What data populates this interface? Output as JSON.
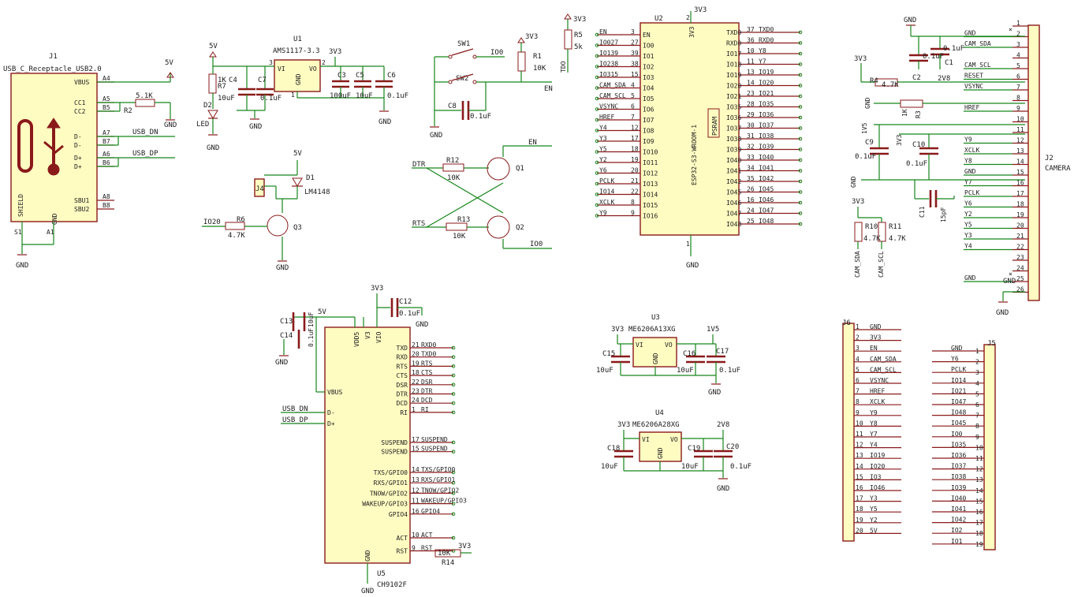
{
  "symbols": {
    "usb": {
      "ref": "J1",
      "value": "USB_C_Receptacle_USB2.0",
      "pins": [
        {
          "num": "A4",
          "name": "VBUS"
        },
        {
          "num": "A5",
          "name": "CC1"
        },
        {
          "num": "B5",
          "name": "CC2"
        },
        {
          "num": "A7",
          "name": "D-"
        },
        {
          "num": "B7",
          "name": "D-"
        },
        {
          "num": "A6",
          "name": "D+"
        },
        {
          "num": "B6",
          "name": "D+"
        },
        {
          "num": "A8",
          "name": "SBU1"
        },
        {
          "num": "B8",
          "name": "SBU2"
        }
      ],
      "shield_label": "SHIELD",
      "gnd_label": "GND",
      "s1": "S1",
      "a1": "A1"
    },
    "ldo": {
      "ref": "U1",
      "value": "AMS1117-3.3",
      "vi": "VI",
      "vo": "VO",
      "gnd": "GND",
      "pin_vi": "3",
      "pin_vo": "2",
      "pin_gnd": "1"
    },
    "esp": {
      "ref": "U2",
      "value": "ESP32-S3-WROOM-1",
      "psram": "PSRAM",
      "left_pins": [
        {
          "num": "3",
          "name": "EN",
          "net": "EN"
        },
        {
          "num": "27",
          "name": "IO0",
          "net": "IO027"
        },
        {
          "num": "39",
          "name": "IO1",
          "net": "IO139"
        },
        {
          "num": "38",
          "name": "IO2",
          "net": "IO238"
        },
        {
          "num": "15",
          "name": "IO3",
          "net": "IO315"
        },
        {
          "num": "4",
          "name": "IO4",
          "net": "CAM_SDA"
        },
        {
          "num": "5",
          "name": "IO5",
          "net": "CAM_SCL"
        },
        {
          "num": "6",
          "name": "IO6",
          "net": "VSYNC"
        },
        {
          "num": "7",
          "name": "IO7",
          "net": "HREF"
        },
        {
          "num": "12",
          "name": "IO8",
          "net": "Y4"
        },
        {
          "num": "17",
          "name": "IO9",
          "net": "Y3"
        },
        {
          "num": "18",
          "name": "IO10",
          "net": "Y5"
        },
        {
          "num": "19",
          "name": "IO11",
          "net": "Y2"
        },
        {
          "num": "20",
          "name": "IO12",
          "net": "Y6"
        },
        {
          "num": "21",
          "name": "IO13",
          "net": "PCLK"
        },
        {
          "num": "22",
          "name": "IO14",
          "net": "IO14"
        },
        {
          "num": "8",
          "name": "IO15",
          "net": "XCLK"
        },
        {
          "num": "9",
          "name": "IO16",
          "net": "Y9"
        }
      ],
      "right_pins": [
        {
          "num": "37",
          "name": "TXD0",
          "net": "TXD0"
        },
        {
          "num": "36",
          "name": "RXD0",
          "net": "RXD0"
        },
        {
          "num": "10",
          "name": "IO17",
          "net": "Y8"
        },
        {
          "num": "11",
          "name": "IO18",
          "net": "Y7"
        },
        {
          "num": "13",
          "name": "IO19",
          "net": "IO19"
        },
        {
          "num": "14",
          "name": "IO20",
          "net": "IO20"
        },
        {
          "num": "23",
          "name": "IO21",
          "net": "IO21"
        },
        {
          "num": "28",
          "name": "IO35",
          "net": "IO35"
        },
        {
          "num": "29",
          "name": "IO36",
          "net": "IO36"
        },
        {
          "num": "30",
          "name": "IO37",
          "net": "IO37"
        },
        {
          "num": "31",
          "name": "IO38",
          "net": "IO38"
        },
        {
          "num": "32",
          "name": "IO39",
          "net": "IO39"
        },
        {
          "num": "33",
          "name": "IO40",
          "net": "IO40"
        },
        {
          "num": "34",
          "name": "IO41",
          "net": "IO41"
        },
        {
          "num": "35",
          "name": "IO42",
          "net": "IO42"
        },
        {
          "num": "26",
          "name": "IO45",
          "net": "IO45"
        },
        {
          "num": "16",
          "name": "IO46",
          "net": "IO46"
        },
        {
          "num": "24",
          "name": "IO47",
          "net": "IO47"
        },
        {
          "num": "25",
          "name": "IO48",
          "net": "IO48"
        }
      ],
      "top_pin": "2",
      "top_label": "3V3",
      "bottom_pin": "1",
      "bottom_label": "GND"
    },
    "camera": {
      "ref": "J2",
      "value": "CAMERA",
      "nets": [
        "",
        "GND",
        "CAM_SDA",
        "",
        "CAM_SCL",
        "RESET",
        "VSYNC",
        "",
        "HREF",
        "",
        "",
        "Y9",
        "XCLK",
        "Y8",
        "GND",
        "Y7",
        "PCLK",
        "Y6",
        "Y2",
        "Y5",
        "Y3",
        "Y4",
        "",
        "",
        "GND",
        ""
      ]
    },
    "ch9102": {
      "ref": "U5",
      "value": "CH9102F",
      "left_top": [
        "VDD5",
        "V3",
        "VIO"
      ],
      "vbus": "VBUS",
      "dm": "D-",
      "dp": "D+",
      "right_pins": [
        {
          "num": "21",
          "name": "TXD",
          "net": "RXD0"
        },
        {
          "num": "20",
          "name": "RXD",
          "net": "TXD0"
        },
        {
          "num": "19",
          "name": "RTS",
          "net": "RTS"
        },
        {
          "num": "18",
          "name": "CTS",
          "net": "CTS"
        },
        {
          "num": "22",
          "name": "DSR",
          "net": "DSR"
        },
        {
          "num": "23",
          "name": "DTR",
          "net": "DTR"
        },
        {
          "num": "24",
          "name": "DCD",
          "net": "DCD"
        },
        {
          "num": "1",
          "name": "RI",
          "net": "RI"
        },
        {
          "num": "17",
          "name": "SUSPEND",
          "net": "SUSPEND"
        },
        {
          "num": "15",
          "name": "SUSPEND",
          "net": "SUSPEND"
        },
        {
          "num": "14",
          "name": "TXS/GPIO0",
          "net": "TXS/GPIO0"
        },
        {
          "num": "13",
          "name": "RXS/GPIO1",
          "net": "RXS/GPIO1"
        },
        {
          "num": "12",
          "name": "TNOW/GPIO2",
          "net": "TNOW/GPIO2"
        },
        {
          "num": "11",
          "name": "WAKEUP/GPIO3",
          "net": "WAKEUP/GPIO3"
        },
        {
          "num": "16",
          "name": "GPIO4",
          "net": "GPIO4"
        },
        {
          "num": "10",
          "name": "ACT",
          "net": "ACT"
        },
        {
          "num": "9",
          "name": "RST",
          "net": "RST"
        }
      ],
      "gnd": "GND",
      "r14": "R14",
      "r14_val": "10K"
    },
    "j3": {
      "ref": "U3",
      "value": "ME6206A13XG",
      "vi": "VI",
      "vo": "VO",
      "gnd": "GND"
    },
    "u4": {
      "ref": "U4",
      "value": "ME6206A28XG",
      "vi": "VI",
      "vo": "VO",
      "gnd": "GND"
    },
    "j6": {
      "ref": "J6",
      "labels": [
        "GND",
        "3V3",
        "EN",
        "CAM_SDA",
        "CAM_SCL",
        "VSYNC",
        "HREF",
        "XCLK",
        "Y9",
        "Y8",
        "Y7",
        "Y4",
        "IO19",
        "IO20",
        "IO3",
        "IO46",
        "Y3",
        "Y5",
        "Y2",
        "5V"
      ]
    },
    "j5": {
      "ref": "J5",
      "labels": [
        "GND",
        "Y6",
        "PCLK",
        "IO14",
        "IO21",
        "IO47",
        "IO48",
        "IO45",
        "IO0",
        "IO35",
        "IO36",
        "IO37",
        "IO38",
        "IO39",
        "IO40",
        "IO41",
        "IO42",
        "IO2",
        "IO1"
      ]
    }
  },
  "labels": {
    "gnd": "GND",
    "v5": "5V",
    "v3v3": "3V3",
    "v2v8": "2V8",
    "r2": "R2",
    "r2v": "5.1K",
    "usb_dn": "USB_DN",
    "usb_dp": "USB_DP",
    "r7": "R7",
    "r7v": "1K",
    "d2": "D2",
    "led": "LED",
    "c4": "C4",
    "c4v": "10uF",
    "c7": "C7",
    "c7v": "0.1uF",
    "c3": "C3",
    "c3v": "100uF",
    "c5": "C5",
    "c5v": "10uF",
    "c6": "C6",
    "c6v": "0.1uF",
    "j4": "J4",
    "d1": "D1",
    "d1v": "LM4148",
    "r6": "R6",
    "r6v": "4.7K",
    "io20": "IO20",
    "q3": "Q3",
    "sw1": "SW1",
    "sw2": "SW2",
    "io0": "IO0",
    "en": "EN",
    "c8": "C8",
    "c8v": "0.1uF",
    "r1": "R1",
    "r1v": "10K",
    "r5": "R5",
    "r5v": "5k",
    "tdo": "TDO",
    "dtr": "DTR",
    "rts": "RTS",
    "r12": "R12",
    "r12v": "10K",
    "r13": "R13",
    "r13v": "10K",
    "q1": "Q1",
    "q2": "Q2",
    "c13": "C13",
    "c14": "C14",
    "c13v": "10uF",
    "c14v": "0.1uF",
    "c12": "C12",
    "c12v": "0.1uF",
    "c15": "C15",
    "c15v": "10uF",
    "c16": "C16",
    "c16v": "10uF",
    "c17": "C17",
    "c17v": "0.1uF",
    "c18": "C18",
    "c18v": "10uF",
    "c19": "C19",
    "c19v": "10uF",
    "c20": "C20",
    "c20v": "0.1uF",
    "r4": "R4",
    "r4v": "4.7K",
    "r3": "R3",
    "r3v": "1K",
    "v1v5": "1V5",
    "c1": "C1",
    "c1v": "0.1uF",
    "c2": "C2",
    "c2v": "0.1uF",
    "c9": "C9",
    "c9v": "0.1uF",
    "c10": "C10",
    "c10v": "0.1uF",
    "c11": "C11",
    "c11v": "15pF",
    "r10": "R10",
    "r10v": "4.7K",
    "r11": "R11",
    "r11v": "4.7K",
    "cam_sda": "CAM_SDA",
    "cam_scl": "CAM_SCL"
  }
}
